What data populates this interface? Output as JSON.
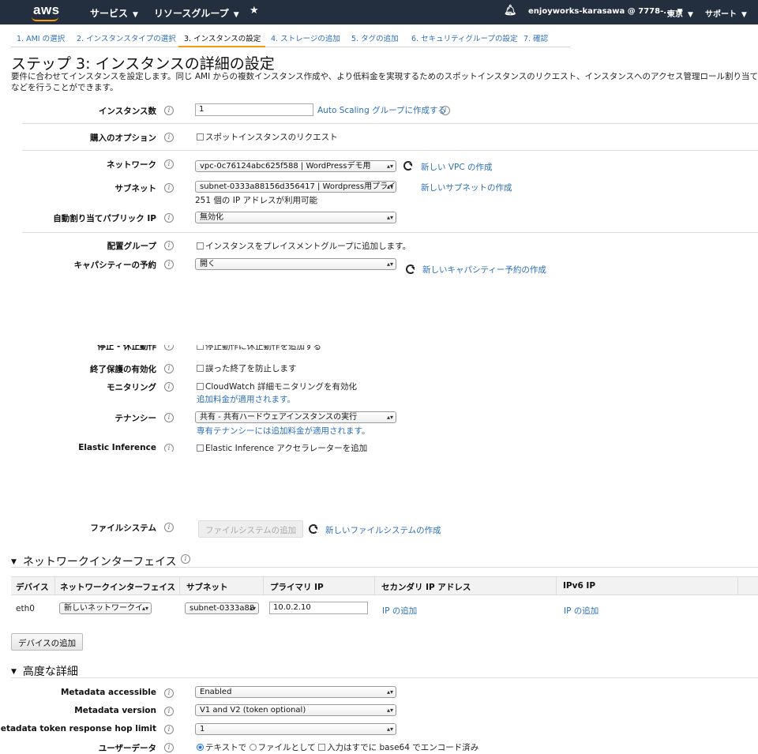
{
  "topnav": {
    "logo": "aws",
    "services": "サービス",
    "resource_groups": "リソースグループ",
    "account": "enjoyworks-karasawa @ 7778-...",
    "region": "東京",
    "support": "サポート",
    "bg_color": "#232f3e",
    "accent_color": "#ff9900"
  },
  "steps": [
    {
      "label": "1. AMI の選択"
    },
    {
      "label": "2. インスタンスタイプの選択"
    },
    {
      "label": "3. インスタンスの設定"
    },
    {
      "label": "4. ストレージの追加"
    },
    {
      "label": "5. タグの追加"
    },
    {
      "label": "6. セキュリティグループの設定"
    },
    {
      "label": "7. 確認"
    }
  ],
  "page": {
    "title": "ステップ 3: インスタンスの詳細の設定",
    "description": "要件に合わせてインスタンスを設定します。同じ AMI からの複数インスタンス作成や、より低料金を実現するためのスポットインスタンスのリクエスト、インスタンスへのアクセス管理ロール割り当てなどを行うことができます。"
  },
  "form": {
    "instance_count": {
      "label": "インスタンス数",
      "value": "1",
      "link": "Auto Scaling グループに作成する"
    },
    "purchase_option": {
      "label": "購入のオプション",
      "checkbox": "スポットインスタンスのリクエスト"
    },
    "network": {
      "label": "ネットワーク",
      "value": "vpc-0c76124abc625f588 | WordPressデモ用",
      "link": "新しい VPC の作成"
    },
    "subnet": {
      "label": "サブネット",
      "value": "subnet-0333a88156d356417 | Wordpress用プライベ",
      "link": "新しいサブネットの作成",
      "note": "251 個の IP アドレスが利用可能"
    },
    "auto_public_ip": {
      "label": "自動割り当てパブリック IP",
      "value": "無効化"
    },
    "placement_group": {
      "label": "配置グループ",
      "checkbox": "インスタンスをプレイスメントグループに追加します。"
    },
    "capacity_reservation": {
      "label": "キャパシティーの予約",
      "value": "開く",
      "link": "新しいキャパシティー予約の作成"
    },
    "stop_hibernate": {
      "label": "停止 - 休止動作",
      "checkbox": "停止動作に休止動作を追加する"
    },
    "termination_protection": {
      "label": "終了保護の有効化",
      "checkbox": "誤った終了を防止します"
    },
    "monitoring": {
      "label": "モニタリング",
      "checkbox": "CloudWatch 詳細モニタリングを有効化",
      "link": "追加料金が適用されます。"
    },
    "tenancy": {
      "label": "テナンシー",
      "value": "共有 - 共有ハードウェアインスタンスの実行",
      "link": "専有テナンシーには追加料金が適用されます。"
    },
    "elastic_inference": {
      "label": "Elastic Inference",
      "checkbox": "Elastic Inference アクセラレーターを追加"
    },
    "file_system": {
      "label": "ファイルシステム",
      "button": "ファイルシステムの追加",
      "link": "新しいファイルシステムの作成"
    }
  },
  "network_interfaces": {
    "title": "ネットワークインターフェイス",
    "columns": [
      "デバイス",
      "ネットワークインターフェイス",
      "サブネット",
      "プライマリ IP",
      "セカンダリ IP アドレス",
      "IPv6 IP"
    ],
    "rows": [
      {
        "device": "eth0",
        "interface": "新しいネットワークイ",
        "subnet": "subnet-0333a88",
        "primary_ip": "10.0.2.10",
        "secondary_link": "IP の追加",
        "ipv6_link": "IP の追加"
      }
    ],
    "add_device_button": "デバイスの追加"
  },
  "advanced": {
    "title": "高度な詳細",
    "metadata_accessible": {
      "label": "Metadata accessible",
      "value": "Enabled"
    },
    "metadata_version": {
      "label": "Metadata version",
      "value": "V1 and V2 (token optional)"
    },
    "hop_limit": {
      "label": "Metadata token response hop limit",
      "value": "1"
    },
    "user_data": {
      "label": "ユーザーデータ",
      "opt_text": "テキストで",
      "opt_file": "ファイルとして",
      "opt_base64": "入力はすでに base64 でエンコード済み"
    }
  }
}
